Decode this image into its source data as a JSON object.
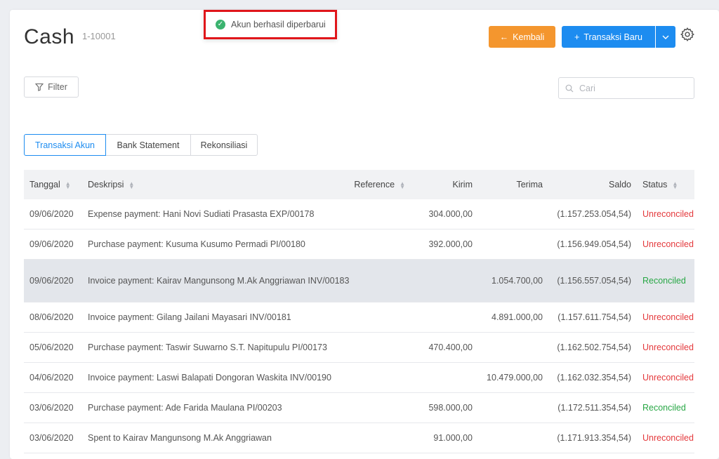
{
  "header": {
    "title": "Cash",
    "account_code": "1-10001",
    "back_label": "Kembali",
    "new_transaction_label": "Transaksi Baru"
  },
  "toast": {
    "message": "Akun berhasil diperbarui"
  },
  "toolbar": {
    "filter_label": "Filter",
    "search_placeholder": "Cari"
  },
  "tabs": [
    {
      "label": "Transaksi Akun",
      "active": true
    },
    {
      "label": "Bank Statement",
      "active": false
    },
    {
      "label": "Rekonsiliasi",
      "active": false
    }
  ],
  "table": {
    "columns": {
      "date": "Tanggal",
      "description": "Deskripsi",
      "reference": "Reference",
      "sent": "Kirim",
      "received": "Terima",
      "balance": "Saldo",
      "status": "Status"
    },
    "rows": [
      {
        "date": "09/06/2020",
        "description": "Expense payment: Hani Novi Sudiati Prasasta EXP/00178",
        "reference": "",
        "sent": "304.000,00",
        "received": "",
        "balance": "(1.157.253.054,54)",
        "status": "Unreconciled"
      },
      {
        "date": "09/06/2020",
        "description": "Purchase payment: Kusuma Kusumo Permadi PI/00180",
        "reference": "",
        "sent": "392.000,00",
        "received": "",
        "balance": "(1.156.949.054,54)",
        "status": "Unreconciled"
      },
      {
        "date": "09/06/2020",
        "description": "Invoice payment: Kairav Mangunsong M.Ak Anggriawan INV/00183",
        "reference": "",
        "sent": "",
        "received": "1.054.700,00",
        "balance": "(1.156.557.054,54)",
        "status": "Reconciled"
      },
      {
        "date": "08/06/2020",
        "description": "Invoice payment: Gilang Jailani Mayasari INV/00181",
        "reference": "",
        "sent": "",
        "received": "4.891.000,00",
        "balance": "(1.157.611.754,54)",
        "status": "Unreconciled"
      },
      {
        "date": "05/06/2020",
        "description": "Purchase payment: Taswir Suwarno S.T. Napitupulu PI/00173",
        "reference": "",
        "sent": "470.400,00",
        "received": "",
        "balance": "(1.162.502.754,54)",
        "status": "Unreconciled"
      },
      {
        "date": "04/06/2020",
        "description": "Invoice payment: Laswi Balapati Dongoran Waskita INV/00190",
        "reference": "",
        "sent": "",
        "received": "10.479.000,00",
        "balance": "(1.162.032.354,54)",
        "status": "Unreconciled"
      },
      {
        "date": "03/06/2020",
        "description": "Purchase payment: Ade Farida Maulana PI/00203",
        "reference": "",
        "sent": "598.000,00",
        "received": "",
        "balance": "(1.172.511.354,54)",
        "status": "Reconciled"
      },
      {
        "date": "03/06/2020",
        "description": "Spent to Kairav Mangunsong M.Ak Anggriawan",
        "reference": "",
        "sent": "91.000,00",
        "received": "",
        "balance": "(1.171.913.354,54)",
        "status": "Unreconciled"
      }
    ]
  },
  "colors": {
    "primary": "#1d8cf0",
    "back_button": "#f4962e",
    "reconciled": "#28a745",
    "unreconciled": "#e4393c",
    "highlight_row": "#e3e6eb",
    "toast_border": "#e0161b"
  }
}
